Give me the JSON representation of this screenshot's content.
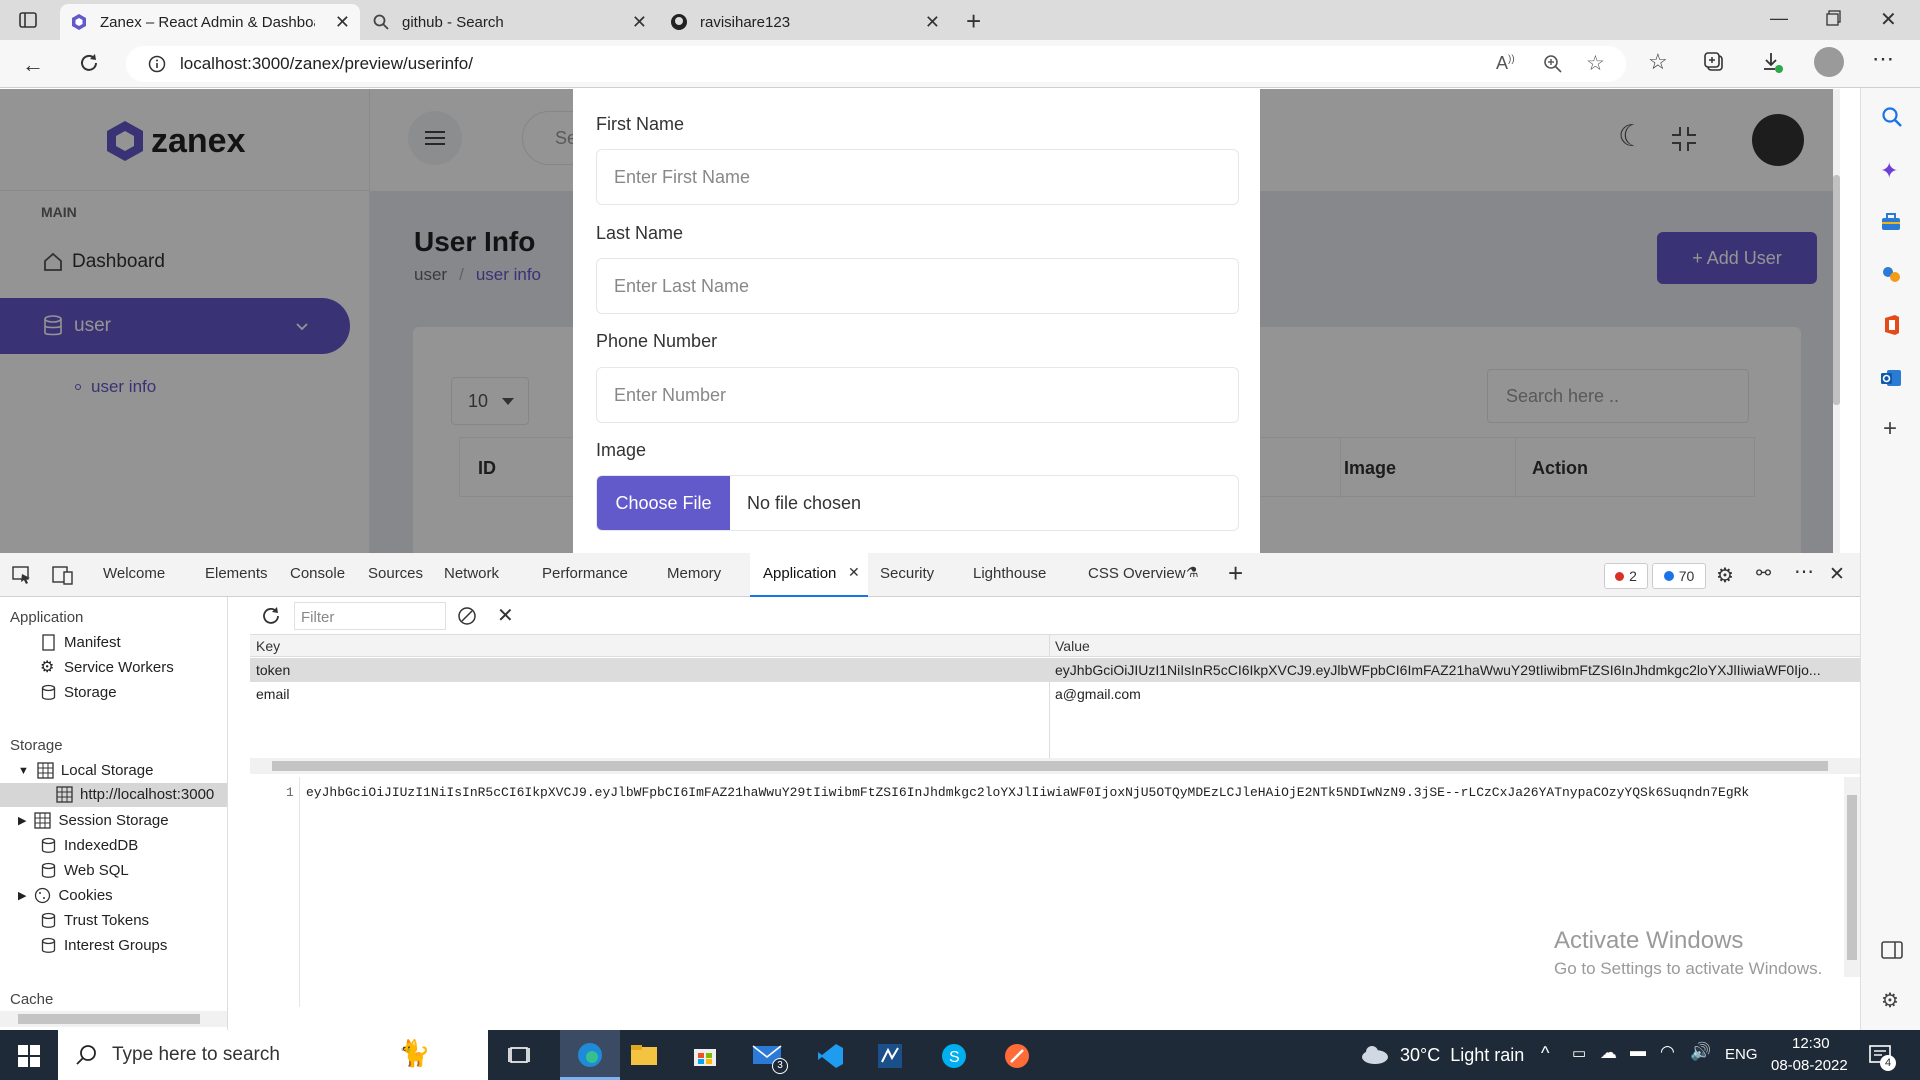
{
  "browser": {
    "tabs": [
      {
        "title": "Zanex – React Admin & Dashboa",
        "active": true,
        "icon": "zanex-favicon"
      },
      {
        "title": "github - Search",
        "active": false,
        "icon": "search-icon"
      },
      {
        "title": "ravisihare123",
        "active": false,
        "icon": "github-icon"
      }
    ],
    "url": "localhost:3000/zanex/preview/userinfo/"
  },
  "app": {
    "brand": "zanex",
    "sidebar": {
      "section": "MAIN",
      "items": [
        {
          "label": "Dashboard",
          "icon": "home-icon"
        },
        {
          "label": "user",
          "icon": "database-icon",
          "active": true
        }
      ],
      "subitem": "user info"
    },
    "search_placeholder": "Se",
    "page_title": "User Info",
    "breadcrumb": [
      "user",
      "user info"
    ],
    "breadcrumb_sep": "/",
    "add_user_label": "+ Add User",
    "entries_value": "10",
    "table_search_placeholder": "Search here ..",
    "table_headers": [
      "ID",
      "Image",
      "Action"
    ]
  },
  "modal": {
    "fields": [
      {
        "label": "First Name",
        "placeholder": "Enter First Name"
      },
      {
        "label": "Last Name",
        "placeholder": "Enter Last Name"
      },
      {
        "label": "Phone Number",
        "placeholder": "Enter Number"
      }
    ],
    "image_label": "Image",
    "choose_file": "Choose File",
    "no_file": "No file chosen"
  },
  "devtools": {
    "tabs": [
      "Welcome",
      "Elements",
      "Console",
      "Sources",
      "Network",
      "Performance",
      "Memory",
      "Application",
      "Security",
      "Lighthouse",
      "CSS Overview"
    ],
    "active_tab": "Application",
    "errors": "2",
    "issues": "70",
    "sidebar": {
      "application_header": "Application",
      "application_items": [
        "Manifest",
        "Service Workers",
        "Storage"
      ],
      "storage_header": "Storage",
      "local_storage": "Local Storage",
      "local_storage_origin": "http://localhost:3000",
      "storage_items": [
        "Session Storage",
        "IndexedDB",
        "Web SQL",
        "Cookies",
        "Trust Tokens",
        "Interest Groups"
      ],
      "cache_header": "Cache"
    },
    "filter_placeholder": "Filter",
    "table": {
      "headers": [
        "Key",
        "Value"
      ],
      "rows": [
        {
          "key": "token",
          "value": "eyJhbGciOiJIUzI1NiIsInR5cCI6IkpXVCJ9.eyJlbWFpbCI6ImFAZ21haWwuY29tIiwibmFtZSI6InJhdmkgc2loYXJlIiwiaWF0Ijo..."
        },
        {
          "key": "email",
          "value": "a@gmail.com"
        }
      ]
    },
    "preview_line_no": "1",
    "preview_text": "eyJhbGciOiJIUzI1NiIsInR5cCI6IkpXVCJ9.eyJlbWFpbCI6ImFAZ21haWwuY29tIiwibmFtZSI6InJhdmkgc2loYXJlIiwiaWF0IjoxNjU5OTQyMDEzLCJleHAiOjE2NTk5NDIwNzN9.3jSE--rLCzCxJa26YATnypaCOzyYQSk6Suqndn7EgRk"
  },
  "watermark": {
    "line1": "Activate Windows",
    "line2": "Go to Settings to activate Windows."
  },
  "taskbar": {
    "search_placeholder": "Type here to search",
    "weather": "30°C  Light rain",
    "lang": "ENG",
    "time": "12:30",
    "date": "08-08-2022",
    "notification_count": "4",
    "mail_badge": "3"
  }
}
